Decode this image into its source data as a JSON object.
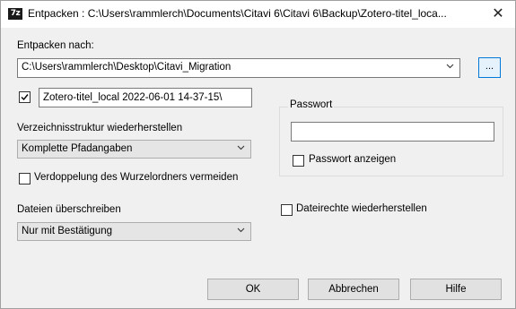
{
  "window": {
    "icon_text": "7z",
    "title": "Entpacken : C:\\Users\\rammlerch\\Documents\\Citavi 6\\Citavi 6\\Backup\\Zotero-titel_loca...",
    "close_symbol": "✕"
  },
  "extract_to": {
    "label": "Entpacken nach:",
    "path": "C:\\Users\\rammlerch\\Desktop\\Citavi_Migration",
    "browse_label": "..."
  },
  "subfolder": {
    "checked": true,
    "value": "Zotero-titel_local 2022-06-01 14-37-15\\"
  },
  "password": {
    "group_label": "Passwort",
    "value": "",
    "show_label": "Passwort anzeigen",
    "show_checked": false
  },
  "directory_structure": {
    "label": "Verzeichnisstruktur wiederherstellen",
    "selected": "Komplette Pfadangaben"
  },
  "avoid_duplication": {
    "label": "Verdoppelung des Wurzelordners vermeiden",
    "checked": false
  },
  "overwrite": {
    "label": "Dateien überschreiben",
    "selected": "Nur mit Bestätigung"
  },
  "restore_permissions": {
    "label": "Dateirechte wiederherstellen",
    "checked": false
  },
  "buttons": {
    "ok": "OK",
    "cancel": "Abbrechen",
    "help": "Hilfe"
  },
  "colors": {
    "accent": "#0078d7",
    "dialog_bg": "#f0f0f0",
    "button_bg": "#e1e1e1"
  }
}
